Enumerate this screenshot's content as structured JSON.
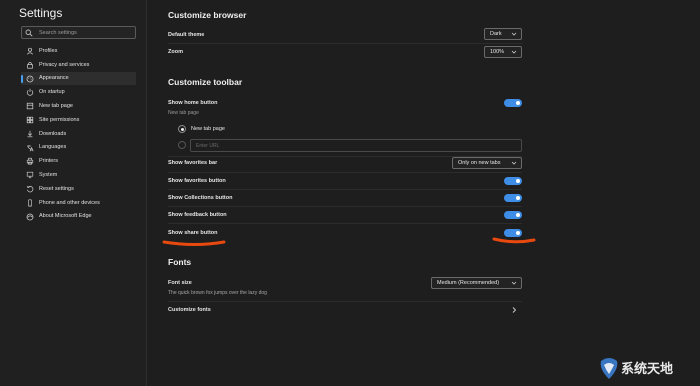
{
  "sidebar": {
    "title": "Settings",
    "search_placeholder": "Search settings",
    "items": [
      {
        "label": "Profiles",
        "icon": "person-icon"
      },
      {
        "label": "Privacy and services",
        "icon": "lock-icon"
      },
      {
        "label": "Appearance",
        "icon": "palette-icon",
        "active": true
      },
      {
        "label": "On startup",
        "icon": "power-icon"
      },
      {
        "label": "New tab page",
        "icon": "home-grid-icon"
      },
      {
        "label": "Site permissions",
        "icon": "site-grid-icon"
      },
      {
        "label": "Downloads",
        "icon": "download-icon"
      },
      {
        "label": "Languages",
        "icon": "languages-icon"
      },
      {
        "label": "Printers",
        "icon": "printer-icon"
      },
      {
        "label": "System",
        "icon": "monitor-icon"
      },
      {
        "label": "Reset settings",
        "icon": "reset-icon"
      },
      {
        "label": "Phone and other devices",
        "icon": "phone-icon"
      },
      {
        "label": "About Microsoft Edge",
        "icon": "edge-logo-icon"
      }
    ]
  },
  "customize_browser": {
    "heading": "Customize browser",
    "default_theme_label": "Default theme",
    "default_theme_value": "Dark",
    "zoom_label": "Zoom",
    "zoom_value": "100%"
  },
  "customize_toolbar": {
    "heading": "Customize toolbar",
    "home_button_label": "Show home button",
    "home_button_sublabel": "New tab page",
    "home_button_on": true,
    "radio_new_tab_label": "New tab page",
    "radio_url_placeholder": "Enter URL",
    "favorites_bar_label": "Show favorites bar",
    "favorites_bar_value": "Only on new tabs",
    "favorites_button_label": "Show favorites button",
    "favorites_button_on": true,
    "collections_button_label": "Show Collections button",
    "collections_button_on": true,
    "feedback_button_label": "Show feedback button",
    "feedback_button_on": true,
    "share_button_label": "Show share button",
    "share_button_on": true
  },
  "fonts": {
    "heading": "Fonts",
    "font_size_label": "Font size",
    "font_size_value": "Medium (Recommended)",
    "preview_text": "The quick brown fox jumps over the lazy dog",
    "customize_fonts_label": "Customize fonts"
  },
  "colors": {
    "accent": "#3e8ee8",
    "annotation": "#e8490f",
    "background": "#1e1e1e"
  },
  "watermark": {
    "text": "系统天地",
    "icon": "watermark-logo-icon"
  }
}
